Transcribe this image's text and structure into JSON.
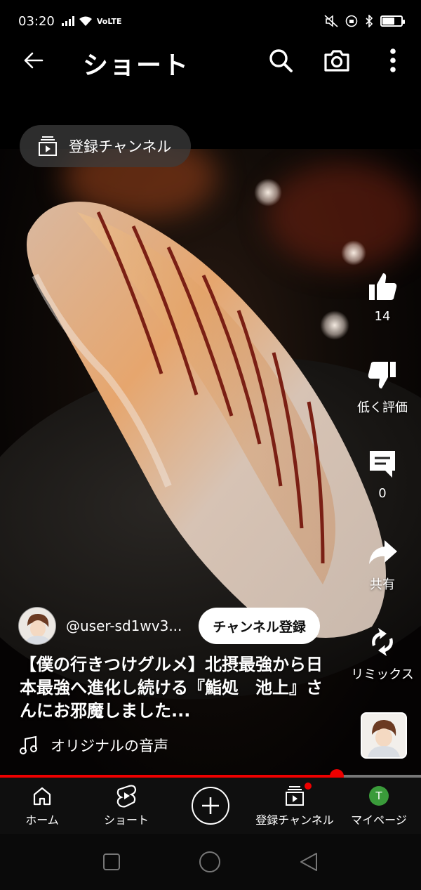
{
  "status_bar": {
    "time": "03:20",
    "network": "VoLTE",
    "battery_level": 0.6
  },
  "header": {
    "title": "ショート",
    "icons": [
      "back-arrow-icon",
      "search-icon",
      "camera-icon",
      "more-vert-icon"
    ]
  },
  "chip": {
    "label": "登録チャンネル",
    "icon": "subscriptions-icon"
  },
  "actions": {
    "like_count": "14",
    "dislike_label": "低く評価",
    "comment_count": "0",
    "share_label": "共有",
    "remix_label": "リミックス"
  },
  "video": {
    "channel_handle": "@user-sd1wv3...",
    "subscribe_label": "チャンネル登録",
    "caption": "【僕の行きつけグルメ】北摂最強から日本最強へ進化し続ける『鮨処　池上』さんにお邪魔しました...",
    "music_label": "オリジナルの音声",
    "progress": 0.8
  },
  "bottom_nav": {
    "items": [
      {
        "label": "ホーム",
        "icon": "home-icon"
      },
      {
        "label": "ショート",
        "icon": "shorts-icon"
      },
      {
        "label": "",
        "icon": "create-plus-icon"
      },
      {
        "label": "登録チャンネル",
        "icon": "subscriptions-icon"
      },
      {
        "label": "マイページ",
        "icon": "avatar-icon",
        "avatar_letter": "T"
      }
    ]
  },
  "colors": {
    "accent": "#ff0000",
    "background": "#000000",
    "avatar_green": "#3a9b3a"
  }
}
